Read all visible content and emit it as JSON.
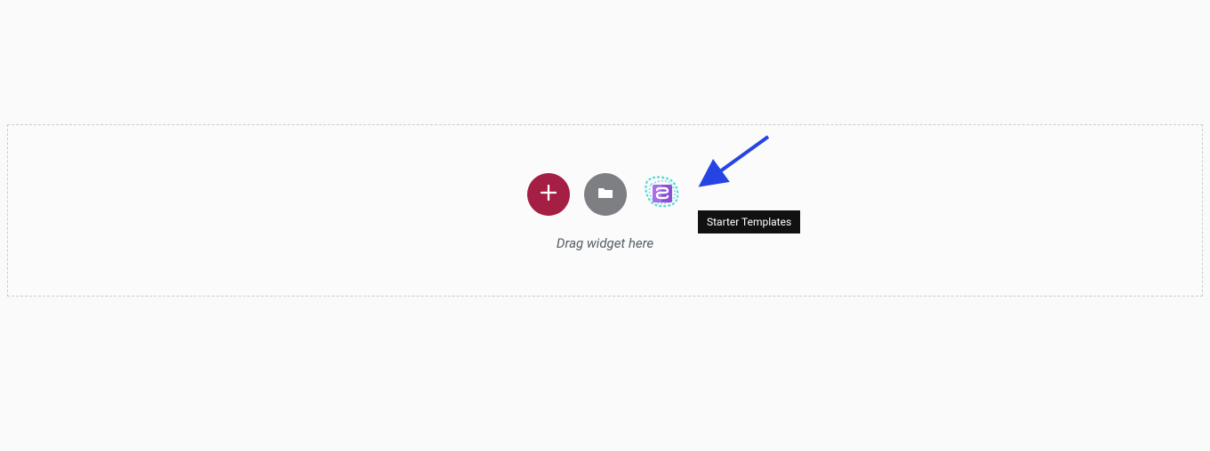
{
  "dropzone": {
    "hint_text": "Drag widget here"
  },
  "buttons": {
    "add": "add-widget",
    "folder": "browse-folder",
    "templates": "starter-templates"
  },
  "tooltip": {
    "text": "Starter Templates"
  },
  "colors": {
    "add_button": "#a51e44",
    "folder_button": "#7d7f82",
    "arrow": "#2544e2",
    "template_accent1": "#3fd6d0",
    "template_accent2": "#a96de8"
  }
}
